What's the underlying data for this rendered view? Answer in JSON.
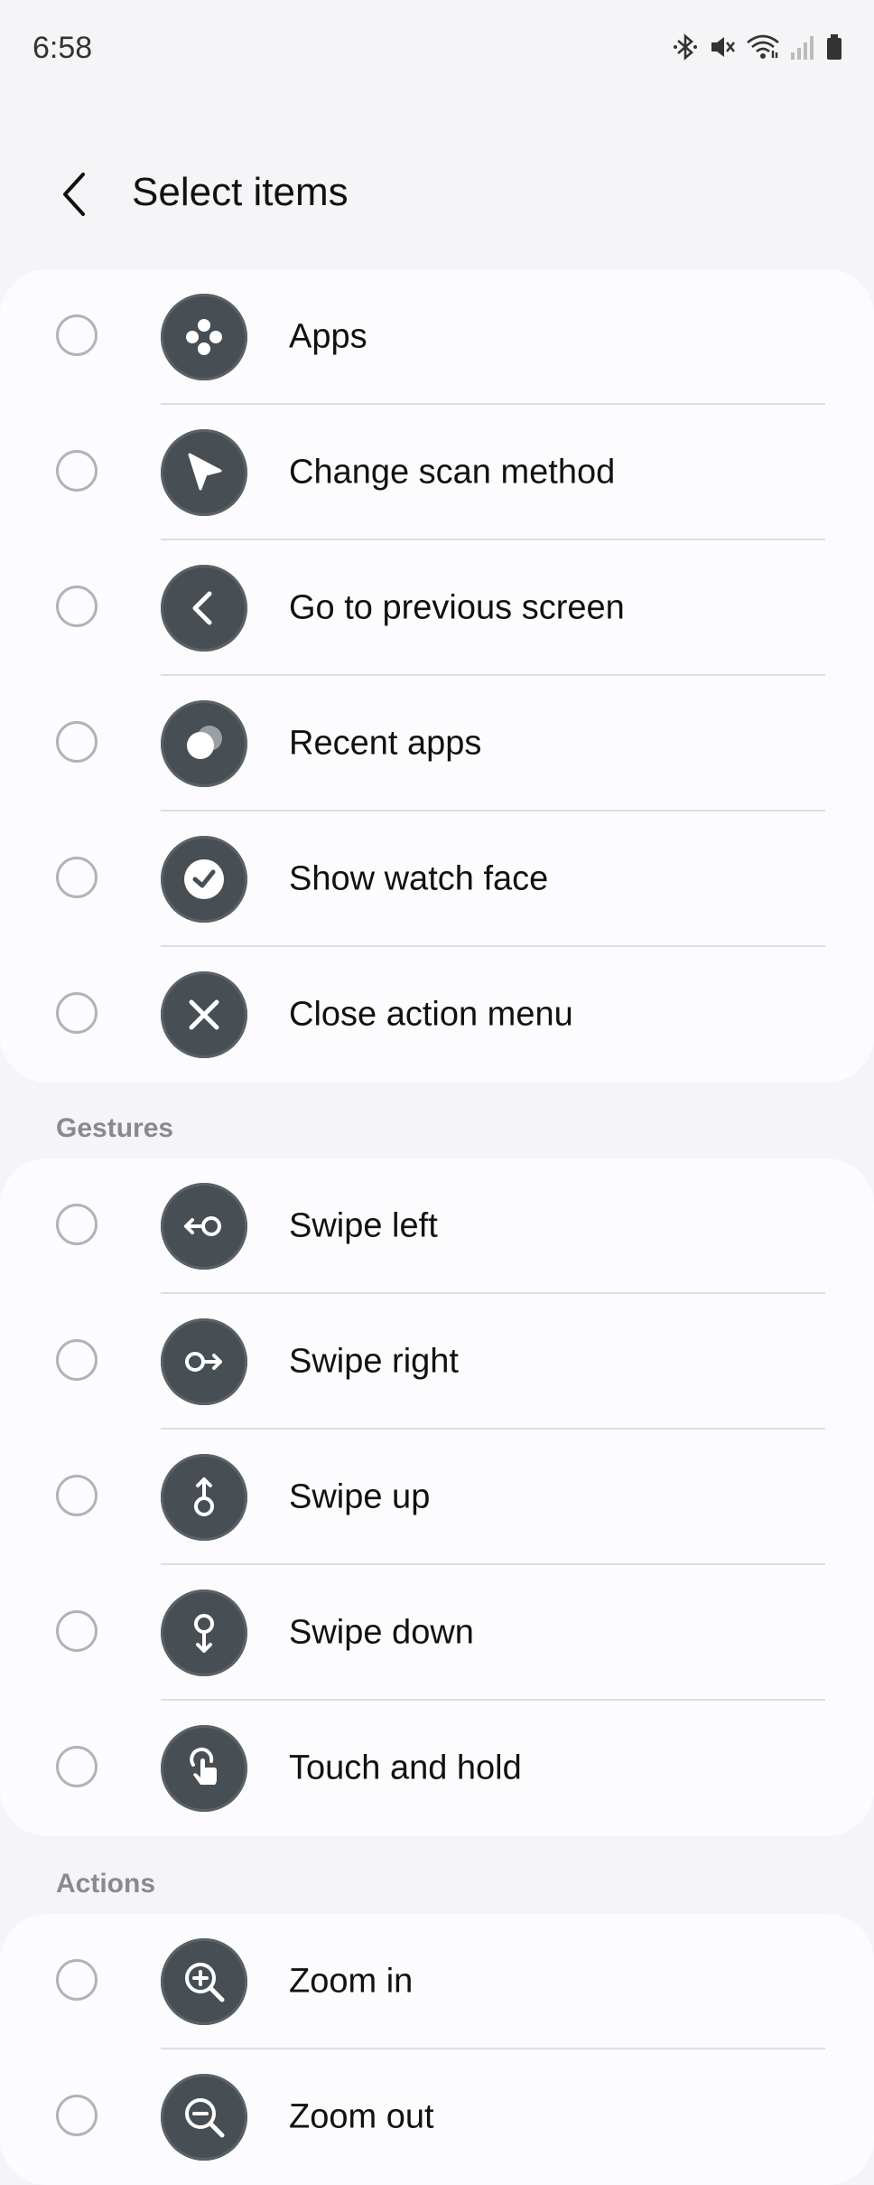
{
  "status": {
    "time": "6:58",
    "icons": [
      "bluetooth-icon",
      "mute-icon",
      "wifi-icon",
      "signal-icon",
      "battery-icon"
    ]
  },
  "header": {
    "title": "Select items",
    "back_icon": "back-arrow-icon"
  },
  "sections": [
    {
      "title": "",
      "items": [
        {
          "label": "Apps",
          "icon": "apps-icon"
        },
        {
          "label": "Change scan method",
          "icon": "pointer-icon"
        },
        {
          "label": "Go to previous screen",
          "icon": "back-chevron-icon"
        },
        {
          "label": "Recent apps",
          "icon": "recent-apps-icon"
        },
        {
          "label": "Show watch face",
          "icon": "watch-face-icon"
        },
        {
          "label": "Close action menu",
          "icon": "close-icon"
        }
      ]
    },
    {
      "title": "Gestures",
      "items": [
        {
          "label": "Swipe left",
          "icon": "swipe-left-icon"
        },
        {
          "label": "Swipe right",
          "icon": "swipe-right-icon"
        },
        {
          "label": "Swipe up",
          "icon": "swipe-up-icon"
        },
        {
          "label": "Swipe down",
          "icon": "swipe-down-icon"
        },
        {
          "label": "Touch and hold",
          "icon": "touch-hold-icon"
        }
      ]
    },
    {
      "title": "Actions",
      "items": [
        {
          "label": "Zoom in",
          "icon": "zoom-in-icon"
        },
        {
          "label": "Zoom out",
          "icon": "zoom-out-icon"
        }
      ]
    }
  ],
  "colors": {
    "background": "#f5f5f7",
    "card": "#fcfcfe",
    "icon_circle": "#474e54",
    "section_header": "#8a8a8e"
  }
}
